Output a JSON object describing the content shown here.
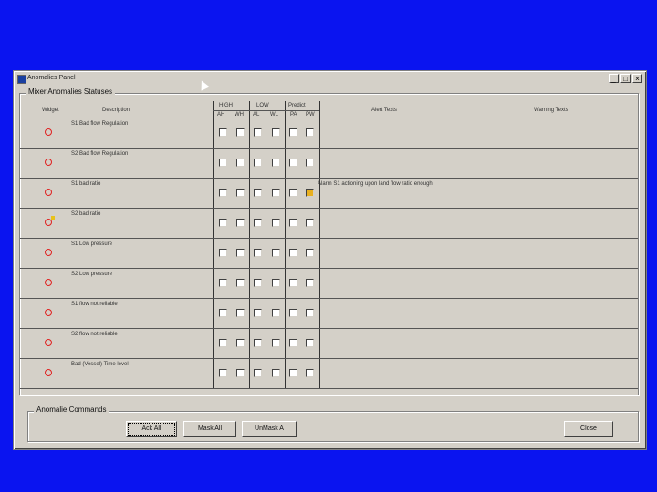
{
  "window": {
    "title": "Anomalies Panel"
  },
  "statuses": {
    "title": "Mixer Anomalies Statuses",
    "headers": {
      "widget": "Widget",
      "description": "Description",
      "high": "HIGH",
      "low": "LOW",
      "predict": "Predict",
      "sub": [
        "AH",
        "WH",
        "AL",
        "WL",
        "PA",
        "PW"
      ],
      "alert_texts": "Alert Texts",
      "warning_texts": "Warning Texts"
    },
    "rows": [
      {
        "description": "S1 Bad flow Regulation",
        "alert": "",
        "checked_pw": false,
        "yellow": false
      },
      {
        "description": "S2 Bad flow Regulation",
        "alert": "",
        "checked_pw": false,
        "yellow": false
      },
      {
        "description": "S1 bad ratio",
        "alert": "Alarm S1 actioning upon land flow ratio enough",
        "checked_pw": true,
        "yellow": false
      },
      {
        "description": "S2 bad ratio",
        "alert": "",
        "checked_pw": false,
        "yellow": true
      },
      {
        "description": "S1 Low pressure",
        "alert": "",
        "checked_pw": false,
        "yellow": false
      },
      {
        "description": "S2 Low pressure",
        "alert": "",
        "checked_pw": false,
        "yellow": false
      },
      {
        "description": "S1 flow not reliable",
        "alert": "",
        "checked_pw": false,
        "yellow": false
      },
      {
        "description": "S2 flow not reliable",
        "alert": "",
        "checked_pw": false,
        "yellow": false
      },
      {
        "description": "Bad (Vessel) Time level",
        "alert": "",
        "checked_pw": false,
        "yellow": false
      }
    ]
  },
  "commands": {
    "title": "Anomalie Commands",
    "ack_all": "Ack All",
    "mask_all": "Mask All",
    "unmask_all": "UnMask A",
    "close": "Close"
  },
  "colors": {
    "desktop": "#0a14f0",
    "led": "#e02020",
    "check": "#e8b020"
  }
}
